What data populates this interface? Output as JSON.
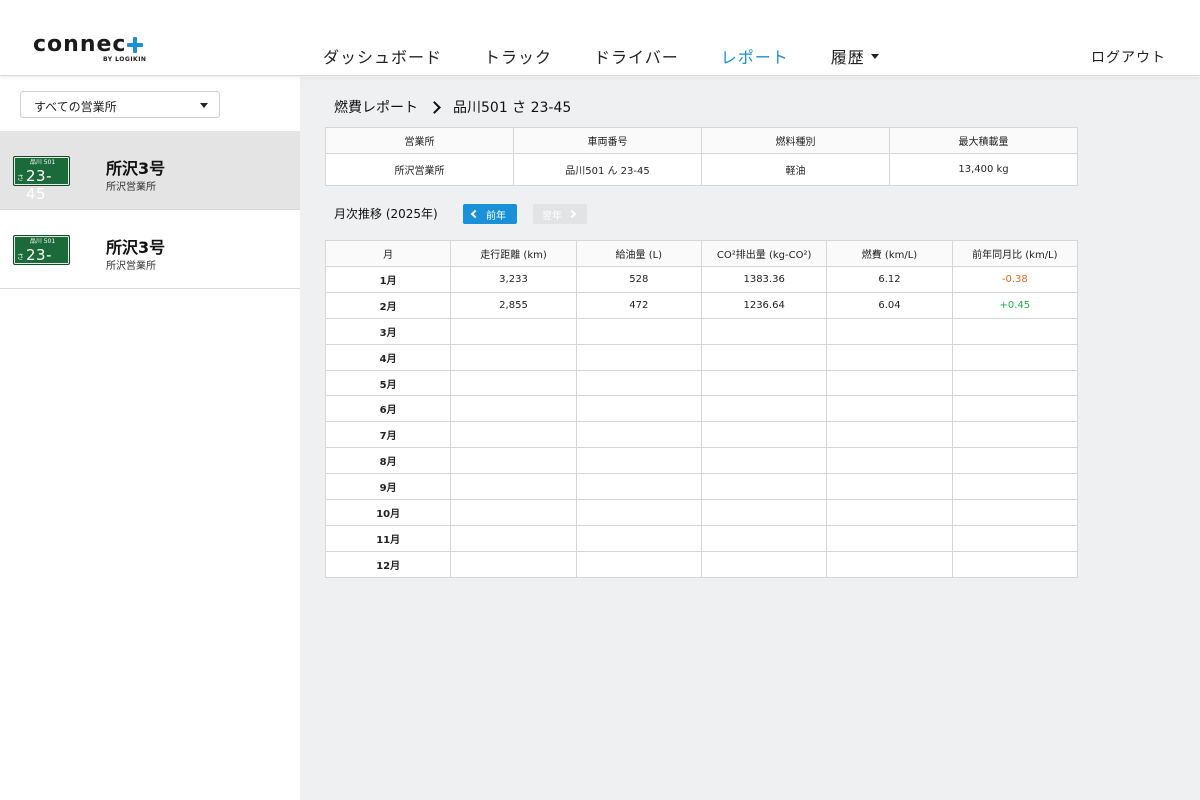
{
  "header": {
    "logo_text": "connec",
    "logo_sub": "BY LOGIKIN",
    "nav": [
      {
        "label": "ダッシュボード",
        "active": false
      },
      {
        "label": "トラック",
        "active": false
      },
      {
        "label": "ドライバー",
        "active": false
      },
      {
        "label": "レポート",
        "active": true
      },
      {
        "label": "履歴",
        "active": false,
        "dropdown": true
      }
    ],
    "logout": "ログアウト",
    "accent_color": "#1a90d8"
  },
  "sidebar": {
    "office_select": "すべての営業所",
    "vehicles": [
      {
        "plate_region": "品川 501",
        "plate_hira": "さ",
        "plate_number": "23-45",
        "name": "所沢3号",
        "office": "所沢営業所",
        "selected": true
      },
      {
        "plate_region": "品川 501",
        "plate_hira": "さ",
        "plate_number": "23-45",
        "name": "所沢3号",
        "office": "所沢営業所",
        "selected": false
      }
    ]
  },
  "main": {
    "breadcrumb": {
      "parent": "燃費レポート",
      "current": "品川501 さ 23-45"
    },
    "info_table": {
      "headers": [
        "営業所",
        "車両番号",
        "燃料種別",
        "最大積載量"
      ],
      "row": [
        "所沢営業所",
        "品川501 ん 23-45",
        "軽油",
        "13,400 kg"
      ]
    },
    "monthly": {
      "title": "月次推移 (2025年)",
      "prev_label": "前年",
      "next_label": "翌年",
      "headers": [
        "月",
        "走行距離 (km)",
        "給油量 (L)",
        "CO²排出量 (kg-CO²)",
        "燃費 (km/L)",
        "前年同月比 (km/L)"
      ],
      "rows": [
        {
          "month": "1月",
          "distance": "3,233",
          "fuel": "528",
          "co2": "1383.36",
          "efficiency": "6.12",
          "yoy": "-0.38"
        },
        {
          "month": "2月",
          "distance": "2,855",
          "fuel": "472",
          "co2": "1236.64",
          "efficiency": "6.04",
          "yoy": "+0.45"
        },
        {
          "month": "3月",
          "distance": "",
          "fuel": "",
          "co2": "",
          "efficiency": "",
          "yoy": ""
        },
        {
          "month": "4月",
          "distance": "",
          "fuel": "",
          "co2": "",
          "efficiency": "",
          "yoy": ""
        },
        {
          "month": "5月",
          "distance": "",
          "fuel": "",
          "co2": "",
          "efficiency": "",
          "yoy": ""
        },
        {
          "month": "6月",
          "distance": "",
          "fuel": "",
          "co2": "",
          "efficiency": "",
          "yoy": ""
        },
        {
          "month": "7月",
          "distance": "",
          "fuel": "",
          "co2": "",
          "efficiency": "",
          "yoy": ""
        },
        {
          "month": "8月",
          "distance": "",
          "fuel": "",
          "co2": "",
          "efficiency": "",
          "yoy": ""
        },
        {
          "month": "9月",
          "distance": "",
          "fuel": "",
          "co2": "",
          "efficiency": "",
          "yoy": ""
        },
        {
          "month": "10月",
          "distance": "",
          "fuel": "",
          "co2": "",
          "efficiency": "",
          "yoy": ""
        },
        {
          "month": "11月",
          "distance": "",
          "fuel": "",
          "co2": "",
          "efficiency": "",
          "yoy": ""
        },
        {
          "month": "12月",
          "distance": "",
          "fuel": "",
          "co2": "",
          "efficiency": "",
          "yoy": ""
        }
      ],
      "negative_color": "#e36b1e",
      "positive_color": "#1fae4c"
    }
  }
}
